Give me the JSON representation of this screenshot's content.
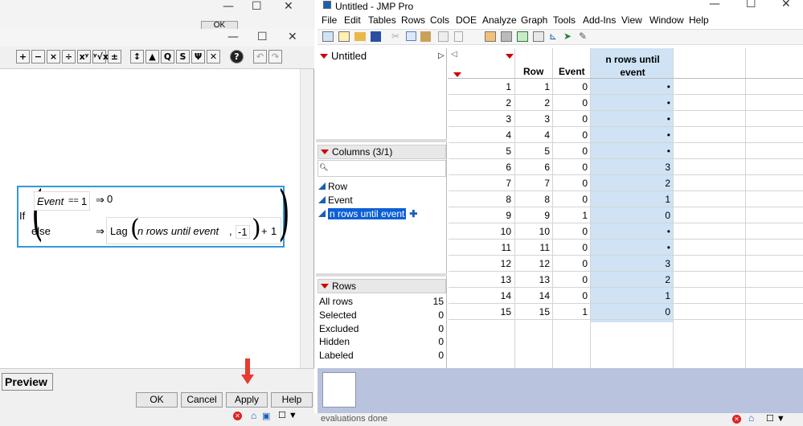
{
  "formula_window": {
    "dialog_ok": "OK",
    "ops": [
      "+",
      "−",
      "×",
      "÷",
      "xʸ",
      "ʸ√x",
      "±",
      "↕",
      "▲",
      "Q",
      "S",
      "Ψ",
      "✕",
      "?"
    ],
    "formula": {
      "if": "If",
      "cond_col": "Event",
      "cond_op": "==",
      "cond_val": "1",
      "arrow": "⇒",
      "then_val": "0",
      "else": "else",
      "lag": "Lag",
      "lag_col": "n rows until event",
      "comma": ",",
      "lag_n": "-1",
      "plus": "+",
      "add": "1"
    },
    "preview": "Preview",
    "buttons": {
      "ok": "OK",
      "cancel": "Cancel",
      "apply": "Apply",
      "help": "Help"
    }
  },
  "jmp": {
    "title": "Untitled - JMP Pro",
    "menu": [
      "File",
      "Edit",
      "Tables",
      "Rows",
      "Cols",
      "DOE",
      "Analyze",
      "Graph",
      "Tools",
      "Add-Ins",
      "View",
      "Window",
      "Help"
    ],
    "table_panel": {
      "name": "Untitled"
    },
    "columns_panel": {
      "header": "Columns (3/1)",
      "columns": [
        "Row",
        "Event",
        "n rows until event"
      ]
    },
    "rows_panel": {
      "header": "Rows",
      "items": [
        {
          "label": "All rows",
          "value": "15"
        },
        {
          "label": "Selected",
          "value": "0"
        },
        {
          "label": "Excluded",
          "value": "0"
        },
        {
          "label": "Hidden",
          "value": "0"
        },
        {
          "label": "Labeled",
          "value": "0"
        }
      ]
    },
    "table": {
      "headers": [
        "Row",
        "Event",
        "n rows until event"
      ],
      "rows": [
        [
          "1",
          "1",
          "0",
          "•"
        ],
        [
          "2",
          "2",
          "0",
          "•"
        ],
        [
          "3",
          "3",
          "0",
          "•"
        ],
        [
          "4",
          "4",
          "0",
          "•"
        ],
        [
          "5",
          "5",
          "0",
          "•"
        ],
        [
          "6",
          "6",
          "0",
          "3"
        ],
        [
          "7",
          "7",
          "0",
          "2"
        ],
        [
          "8",
          "8",
          "0",
          "1"
        ],
        [
          "9",
          "9",
          "1",
          "0"
        ],
        [
          "10",
          "10",
          "0",
          "•"
        ],
        [
          "11",
          "11",
          "0",
          "•"
        ],
        [
          "12",
          "12",
          "0",
          "3"
        ],
        [
          "13",
          "13",
          "0",
          "2"
        ],
        [
          "14",
          "14",
          "0",
          "1"
        ],
        [
          "15",
          "15",
          "1",
          "0"
        ]
      ]
    },
    "status": "evaluations done"
  },
  "colors": {
    "selected_column": "#cfe3f5",
    "accent_red": "#c00000",
    "highlight": "#0d5fd6",
    "formula_border": "#3399dd"
  }
}
